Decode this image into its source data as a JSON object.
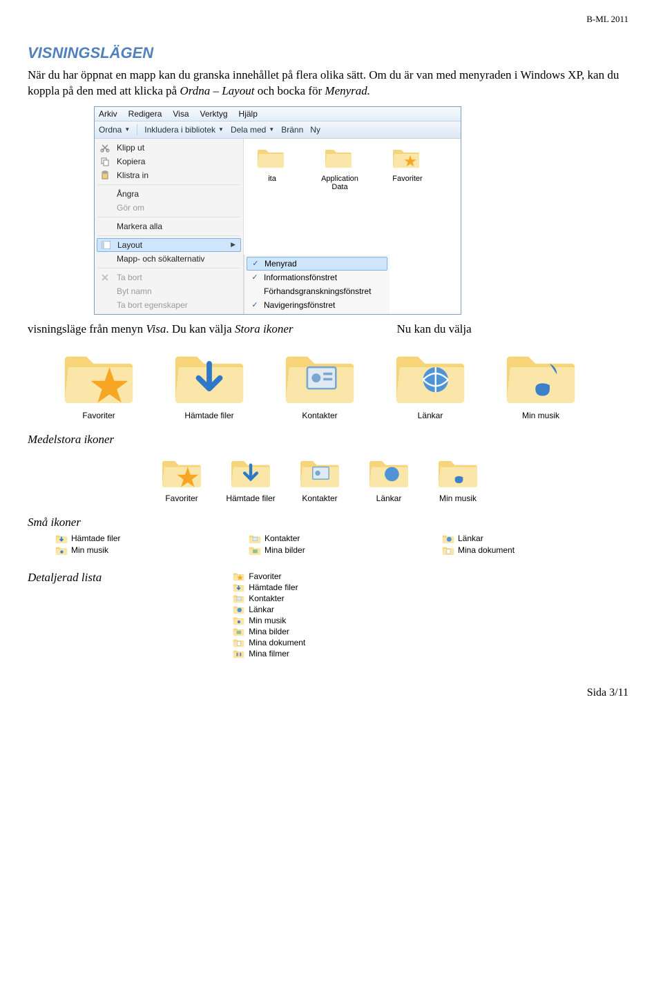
{
  "header": {
    "doc_id": "B-ML 2011"
  },
  "title": "VISNINGSLÄGEN",
  "intro_plain": "När du har öppnat en mapp kan du granska innehållet på flera olika sätt. Om du är van med menyraden i Windows XP, kan du koppla på den med att klicka på ",
  "intro_ordna": "Ordna – Layout",
  "intro_mid": " och bocka för ",
  "intro_menyrad": "Menyrad.",
  "after_menu_prefix": "visningsläge från menyn ",
  "after_menu_visa": "Visa",
  "after_menu_mid": ". Du kan välja ",
  "after_menu_stora": "Stora ikoner",
  "after_menu_right": "Nu kan du välja",
  "sub_medel": "Medelstora ikoner",
  "sub_sma": "Små ikoner",
  "sub_det": "Detaljerad lista",
  "footer": "Sida 3/11",
  "win": {
    "menubar": [
      "Arkiv",
      "Redigera",
      "Visa",
      "Verktyg",
      "Hjälp"
    ],
    "toolbar": {
      "ordna": "Ordna",
      "ink": "Inkludera i bibliotek",
      "dela": "Dela med",
      "brann": "Bränn",
      "ny": "Ny"
    },
    "ctx": {
      "klipp": "Klipp ut",
      "kopiera": "Kopiera",
      "klistra": "Klistra in",
      "angra": "Ångra",
      "gorom": "Gör om",
      "markera": "Markera alla",
      "layout": "Layout",
      "mappsok": "Mapp- och sökalternativ",
      "tabort": "Ta bort",
      "bytnamn": "Byt namn",
      "taborteg": "Ta bort egenskaper"
    },
    "submenu": {
      "menyrad": "Menyrad",
      "info": "Informationsfönstret",
      "forhand": "Förhandsgranskningsfönstret",
      "nav": "Navigeringsfönstret"
    },
    "right_icons": {
      "ita": "ita",
      "appdata": "Application Data",
      "favoriter": "Favoriter"
    }
  },
  "big_labels": [
    "Favoriter",
    "Hämtade filer",
    "Kontakter",
    "Länkar",
    "Min musik"
  ],
  "med_labels": [
    "Favoriter",
    "Hämtade filer",
    "Kontakter",
    "Länkar",
    "Min musik"
  ],
  "small_labels": [
    "Hämtade filer",
    "Kontakter",
    "Länkar",
    "Min musik",
    "Mina bilder",
    "Mina dokument"
  ],
  "det_labels": [
    "Favoriter",
    "Hämtade filer",
    "Kontakter",
    "Länkar",
    "Min musik",
    "Mina bilder",
    "Mina dokument",
    "Mina filmer"
  ]
}
